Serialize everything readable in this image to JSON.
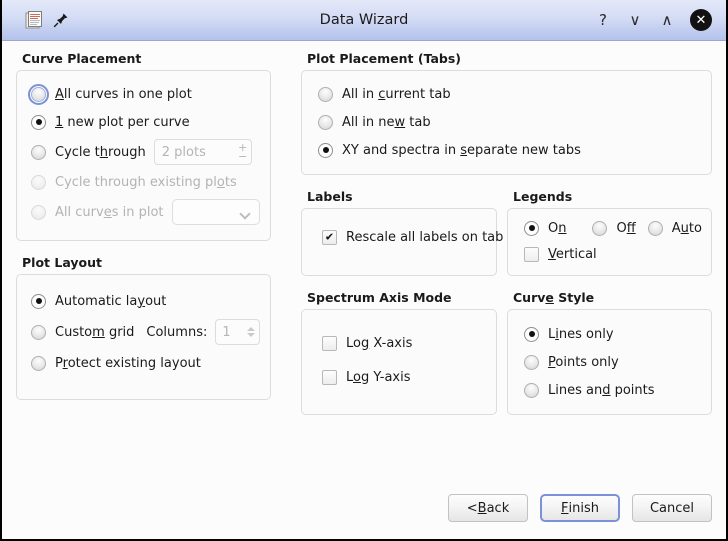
{
  "titlebar": {
    "title": "Data Wizard",
    "app_icon": "document-stack-icon",
    "pin_icon": "pin-icon",
    "help_label": "?",
    "shade_down_label": "∨",
    "shade_up_label": "∧",
    "close_label": "✕"
  },
  "curve_placement": {
    "title": "Curve Placement",
    "options": [
      {
        "label_pre": "",
        "mnemonic": "A",
        "label_post": "ll curves in one plot",
        "checked": false,
        "disabled": false,
        "focused": true
      },
      {
        "label_pre": "",
        "mnemonic": "1",
        "label_post": " new plot per curve",
        "checked": true,
        "disabled": false,
        "focused": false
      },
      {
        "label_pre": "Cycle t",
        "mnemonic": "h",
        "label_post": "rough",
        "checked": false,
        "disabled": false,
        "focused": false
      },
      {
        "label_pre": "Cycle through existing pl",
        "mnemonic": "o",
        "label_post": "ts",
        "checked": false,
        "disabled": true,
        "focused": false
      },
      {
        "label_pre": "All curv",
        "mnemonic": "e",
        "label_post": "s in plot",
        "checked": false,
        "disabled": true,
        "focused": false
      }
    ],
    "cycle_spin": {
      "value": "2 plots",
      "plus": "+",
      "minus": "−"
    },
    "plot_combo": {
      "value": ""
    }
  },
  "plot_layout": {
    "title": "Plot Layout",
    "options": [
      {
        "label_pre": "Automatic la",
        "mnemonic": "y",
        "label_post": "out",
        "checked": true,
        "disabled": false
      },
      {
        "label_pre": "Custo",
        "mnemonic": "m",
        "label_post": " grid",
        "checked": false,
        "disabled": false
      },
      {
        "label_pre": "P",
        "mnemonic": "r",
        "label_post": "otect existing layout",
        "checked": false,
        "disabled": false
      }
    ],
    "columns_label": "Columns:",
    "columns_value": "1"
  },
  "plot_placement": {
    "title": "Plot Placement (Tabs)",
    "options": [
      {
        "label_pre": "All in ",
        "mnemonic": "c",
        "label_post": "urrent tab",
        "checked": false
      },
      {
        "label_pre": "All in ne",
        "mnemonic": "w",
        "label_post": " tab",
        "checked": false
      },
      {
        "label_pre": "XY and spectra in ",
        "mnemonic": "s",
        "label_post": "eparate new tabs",
        "checked": true
      }
    ]
  },
  "labels": {
    "title": "Labels",
    "rescale": {
      "label_pre": "Rescale all labels on tab",
      "mnemonic": "",
      "label_post": "",
      "checked": true
    }
  },
  "legends": {
    "title": "Legends",
    "options": [
      {
        "label_pre": "O",
        "mnemonic": "n",
        "label_post": "",
        "checked": true
      },
      {
        "label_pre": "O",
        "mnemonic": "f",
        "label_post": "f",
        "checked": false
      },
      {
        "label_pre": "A",
        "mnemonic": "u",
        "label_post": "to",
        "checked": false
      }
    ],
    "vertical": {
      "label_pre": "",
      "mnemonic": "V",
      "label_post": "ertical",
      "checked": false
    }
  },
  "spectrum_axis_mode": {
    "title": "Spectrum Axis Mode",
    "options": [
      {
        "label_pre": "Lo",
        "mnemonic": "g",
        "label_post": " X-axis",
        "checked": false
      },
      {
        "label_pre": "L",
        "mnemonic": "o",
        "label_post": "g Y-axis",
        "checked": false
      }
    ]
  },
  "curve_style": {
    "title_pre": "Curv",
    "title_mnemonic": "e",
    "title_post": " Style",
    "title": "Curve Style",
    "options": [
      {
        "label_pre": "L",
        "mnemonic": "i",
        "label_post": "nes only",
        "checked": true
      },
      {
        "label_pre": "",
        "mnemonic": "P",
        "label_post": "oints only",
        "checked": false
      },
      {
        "label_pre": "Lines an",
        "mnemonic": "d",
        "label_post": " points",
        "checked": false
      }
    ]
  },
  "buttons": [
    {
      "name": "back-button",
      "label_pre": "< ",
      "mnemonic": "B",
      "label_post": "ack",
      "default": false
    },
    {
      "name": "finish-button",
      "label_pre": "",
      "mnemonic": "F",
      "label_post": "inish",
      "default": true
    },
    {
      "name": "cancel-button",
      "label_pre": "Cancel",
      "mnemonic": "",
      "label_post": "",
      "default": false
    }
  ],
  "colors": {
    "titlebar_top": "#e4e9f9",
    "titlebar_bottom": "#b4c2ec",
    "dialog_bg": "#fcfcfc",
    "group_border": "#dcdcdc",
    "focus_blue": "#7b93d6",
    "disabled_text": "#b3b3b3"
  }
}
